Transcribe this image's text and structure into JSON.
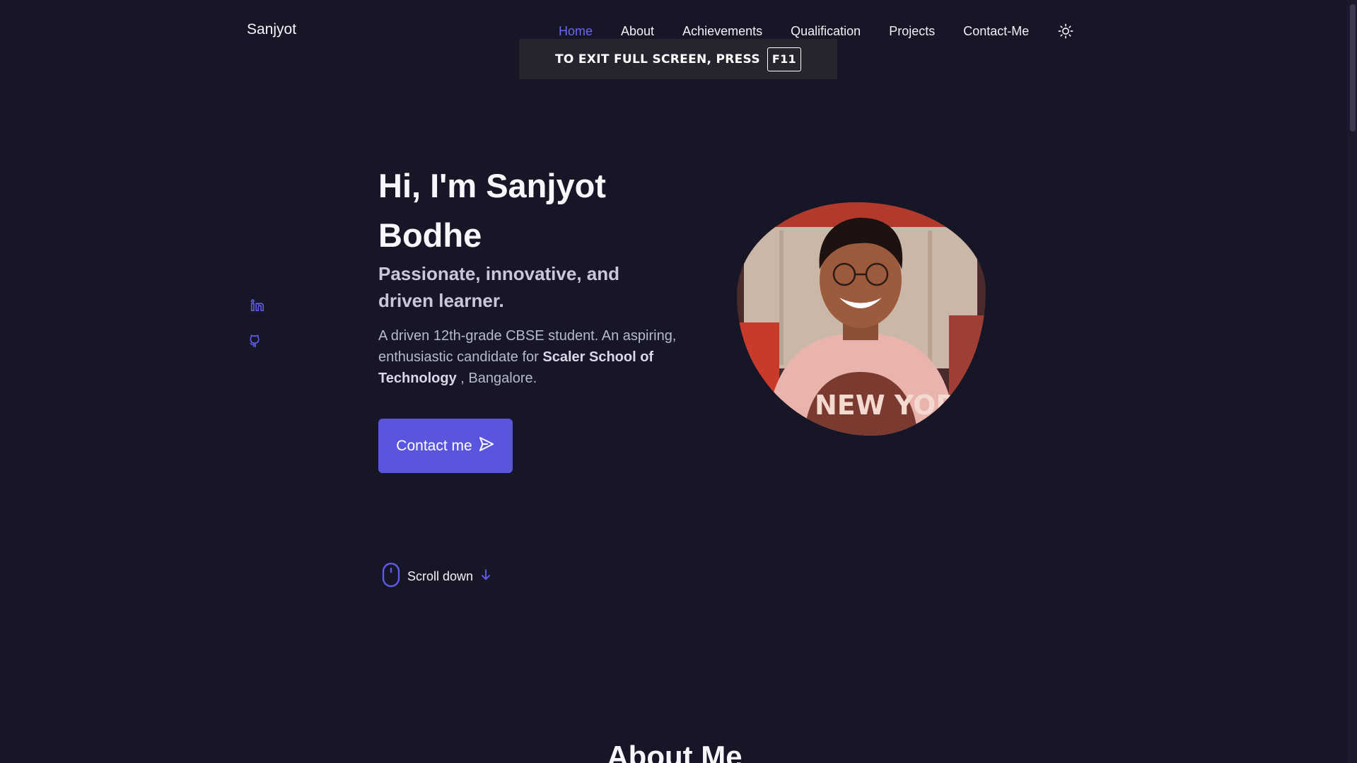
{
  "header": {
    "brand": "Sanjyot",
    "nav": [
      {
        "label": "Home",
        "active": true
      },
      {
        "label": "About"
      },
      {
        "label": "Achievements"
      },
      {
        "label": "Qualification"
      },
      {
        "label": "Projects"
      },
      {
        "label": "Contact-Me"
      }
    ],
    "theme_icon": "sun-icon"
  },
  "fullscreen_notice": {
    "text": "TO EXIT FULL SCREEN, PRESS",
    "key": "F11"
  },
  "social": {
    "items": [
      {
        "icon": "linkedin-icon"
      },
      {
        "icon": "github-icon"
      }
    ]
  },
  "hero": {
    "title": "Hi, I'm Sanjyot Bodhe",
    "subtitle": "Passionate, innovative, and driven learner.",
    "desc_part1": "A driven 12th-grade CBSE student. An aspiring, enthusiastic candidate for ",
    "desc_bold": "Scaler School of Technology",
    "desc_part2": " , Bangalore.",
    "cta_label": "Contact me",
    "cta_icon": "send-icon"
  },
  "scroll": {
    "label": "Scroll down",
    "icon": "mouse-icon",
    "arrow_icon": "arrow-down-icon"
  },
  "about": {
    "title": "About Me"
  },
  "colors": {
    "background": "#171627",
    "accent": "#5a55df",
    "accent_text": "#6c67f0"
  }
}
